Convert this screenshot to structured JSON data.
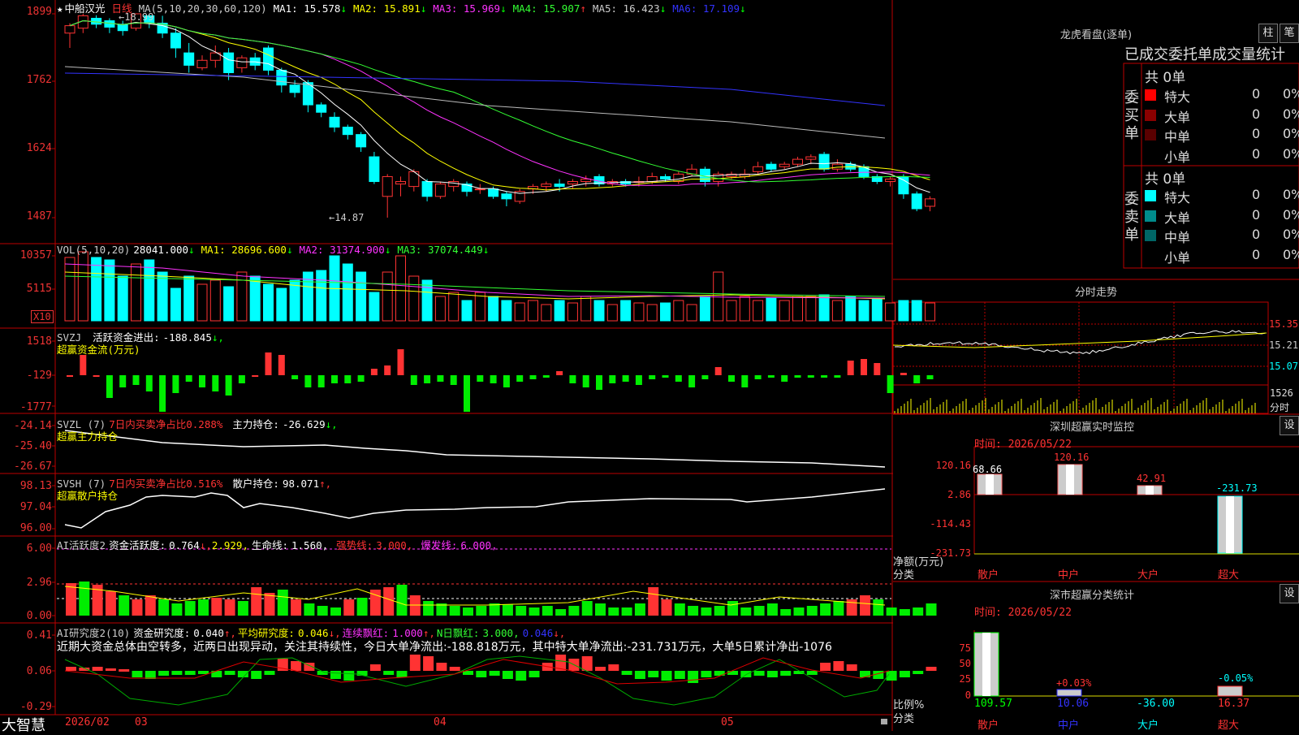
{
  "stock": {
    "star": "★",
    "name": "中船汉光",
    "period": "日线"
  },
  "price_panel": {
    "ma_label": "MA(5,10,20,30,60,120)",
    "ma": [
      {
        "label": "MA1:",
        "value": "15.578",
        "arrow": "↓",
        "color": "#ffffff"
      },
      {
        "label": "MA2:",
        "value": "15.891",
        "arrow": "↓",
        "color": "#ffff00"
      },
      {
        "label": "MA3:",
        "value": "15.969",
        "arrow": "↓",
        "color": "#ff33ff"
      },
      {
        "label": "MA4:",
        "value": "15.907",
        "arrow": "↑",
        "color": "#33ff33"
      },
      {
        "label": "MA5:",
        "value": "16.423",
        "arrow": "↓",
        "color": "#cccccc"
      },
      {
        "label": "MA6:",
        "value": "17.109",
        "arrow": "↓",
        "color": "#3333ff"
      }
    ],
    "y_labels": [
      "1899",
      "1762",
      "1624",
      "1487"
    ],
    "high_note": "←18.99",
    "low_note": "←14.87"
  },
  "vol_panel": {
    "title": "VOL(5,10,20)",
    "value": "28041.000",
    "arrow": "↓",
    "ma": [
      {
        "label": "MA1:",
        "value": "28696.600",
        "arrow": "↓",
        "color": "#ffff00"
      },
      {
        "label": "MA2:",
        "value": "31374.900",
        "arrow": "↓",
        "color": "#ff33ff"
      },
      {
        "label": "MA3:",
        "value": "37074.449",
        "arrow": "↓",
        "color": "#33ff33"
      }
    ],
    "y_labels": [
      "10357",
      "5115"
    ],
    "unit": "X10"
  },
  "svzj_panel": {
    "title": "SVZJ",
    "item": "活跃资金进出:",
    "value": "-188.845",
    "arrow": "↓,",
    "subtitle": "超赢资金流(万元)",
    "y_labels": [
      "1518",
      "-129",
      "-1777"
    ]
  },
  "svzl_panel": {
    "title": "SVZL (7)",
    "item1": "7日内买卖净占比",
    "item1_val": "0.288%",
    "item2": "主力持仓:",
    "item2_val": "-26.629",
    "arrow": "↓,",
    "subtitle": "超赢主力持仓",
    "y_labels": [
      "-24.14",
      "-25.40",
      "-26.67"
    ]
  },
  "svsh_panel": {
    "title": "SVSH (7)",
    "item1": "7日内买卖净占比",
    "item1_val": "0.516%",
    "item2": "散户持仓:",
    "item2_val": "98.071",
    "arrow": "↑,",
    "subtitle": "超赢散户持仓",
    "y_labels": [
      "98.13",
      "97.04",
      "96.00"
    ]
  },
  "ai_active_panel": {
    "title": "AI活跃度2",
    "item1": "资金活跃度:",
    "v1": "0.764",
    "v2": "2.929,",
    "item2": "生命线:",
    "v3": "1.560,",
    "item3": "强势线:",
    "v4": "3.000,",
    "item4": "爆发线:",
    "v5": "6.000,",
    "y_labels": [
      "6.00",
      "2.96",
      "0.00"
    ]
  },
  "ai_research_panel": {
    "title": "AI研究度2(10)",
    "item1": "资金研究度:",
    "v1": "0.040",
    "item2": "平均研究度:",
    "v2": "0.046",
    "item3": "连续飘红:",
    "v3": "1.000",
    "item4": "N日飘红:",
    "v4": "3.000,",
    "v5": "0.046",
    "comment": "近期大资金总体由空转多，近两日出现异动，关注其持续性，今日大单净流出:-188.818万元，其中特大单净流出:-231.731万元，大单5日累计净出-1076",
    "y_labels": [
      "0.41",
      "0.06",
      "-0.29"
    ]
  },
  "time_axis": {
    "labels": [
      "2026/02",
      "03",
      "04",
      "05"
    ]
  },
  "brand": "大智慧",
  "right_panel": {
    "dragon_title": "龙虎看盘(逐单)",
    "btn_bar": "柱",
    "btn_pen": "笔",
    "stats_title": "已成交委托单成交量统计",
    "buy_label": "委买单",
    "sell_label": "委卖单",
    "buy_total": "共 0单",
    "sell_total": "共 0单",
    "buy_rows": [
      {
        "name": "特大",
        "v1": "0",
        "v2": "0%",
        "color": "#ff0000"
      },
      {
        "name": "大单",
        "v1": "0",
        "v2": "0%",
        "color": "#8b0000"
      },
      {
        "name": "中单",
        "v1": "0",
        "v2": "0%",
        "color": "#5a0000"
      },
      {
        "name": "小单",
        "v1": "0",
        "v2": "0%",
        "color": "#000000"
      }
    ],
    "sell_rows": [
      {
        "name": "特大",
        "v1": "0",
        "v2": "0%",
        "color": "#00ffff"
      },
      {
        "name": "大单",
        "v1": "0",
        "v2": "0%",
        "color": "#008b8b"
      },
      {
        "name": "中单",
        "v1": "0",
        "v2": "0%",
        "color": "#006666"
      },
      {
        "name": "小单",
        "v1": "0",
        "v2": "0%",
        "color": "#000000"
      }
    ],
    "intraday_title": "分时走势",
    "intraday_y": [
      "15.35",
      "15.21",
      "15.07"
    ],
    "intraday_vol": "1526",
    "intraday_vol_unit": "分时",
    "monitor_title": "深圳超赢实时监控",
    "monitor_btn": "设",
    "monitor_time": "时间: 2026/05/22",
    "monitor_y": [
      "120.16",
      "2.86",
      "-114.43",
      "-231.73"
    ],
    "monitor_bar_labels": [
      "68.66",
      "120.16",
      "42.91",
      "-231.73"
    ],
    "monitor_unit": "净额(万元)",
    "monitor_class": "分类",
    "categories": [
      "散户",
      "中户",
      "大户",
      "超大"
    ],
    "class_title": "深市超赢分类统计",
    "class_btn": "设",
    "class_time": "时间: 2026/05/22",
    "class_y": [
      "75",
      "50",
      "25",
      "0"
    ],
    "class_pct": [
      "+0.03%",
      "-0.05%"
    ],
    "class_vals": [
      "109.57",
      "10.06",
      "-36.00",
      "16.37"
    ],
    "class_ratio": "比例%",
    "class_class": "分类"
  },
  "chart_data": {
    "type": "candlestick",
    "y_range": [
      14.87,
      18.99
    ],
    "candles": [
      [
        18.6,
        18.75,
        18.3,
        18.8
      ],
      [
        18.7,
        18.95,
        18.6,
        18.99
      ],
      [
        18.9,
        18.78,
        18.7,
        18.96
      ],
      [
        18.85,
        18.72,
        18.6,
        18.9
      ],
      [
        18.78,
        18.65,
        18.55,
        18.85
      ],
      [
        18.7,
        18.99,
        18.65,
        18.99
      ],
      [
        18.95,
        18.8,
        18.7,
        18.99
      ],
      [
        18.8,
        18.6,
        18.5,
        18.95
      ],
      [
        18.6,
        18.3,
        18.1,
        18.7
      ],
      [
        18.2,
        17.95,
        17.8,
        18.4
      ],
      [
        17.9,
        18.05,
        17.85,
        18.15
      ],
      [
        18.05,
        18.2,
        17.9,
        18.35
      ],
      [
        18.2,
        17.8,
        17.65,
        18.3
      ],
      [
        17.9,
        18.1,
        17.8,
        18.15
      ],
      [
        18.1,
        17.95,
        17.85,
        18.2
      ],
      [
        18.3,
        17.85,
        17.75,
        18.35
      ],
      [
        17.85,
        17.55,
        17.4,
        17.9
      ],
      [
        17.55,
        17.4,
        17.3,
        17.65
      ],
      [
        17.6,
        17.15,
        17.0,
        17.65
      ],
      [
        17.15,
        17.0,
        16.9,
        17.2
      ],
      [
        16.9,
        16.7,
        16.6,
        17.0
      ],
      [
        16.7,
        16.55,
        16.45,
        16.75
      ],
      [
        16.55,
        16.3,
        16.2,
        16.6
      ],
      [
        16.1,
        15.6,
        15.55,
        16.2
      ],
      [
        15.3,
        15.7,
        14.87,
        15.75
      ],
      [
        15.55,
        15.6,
        15.3,
        15.7
      ],
      [
        15.5,
        15.8,
        15.4,
        15.85
      ],
      [
        15.6,
        15.3,
        15.2,
        15.65
      ],
      [
        15.3,
        15.55,
        15.25,
        15.6
      ],
      [
        15.5,
        15.6,
        15.4,
        15.65
      ],
      [
        15.55,
        15.4,
        15.3,
        15.6
      ],
      [
        15.45,
        15.45,
        15.35,
        15.55
      ],
      [
        15.45,
        15.3,
        15.25,
        15.5
      ],
      [
        15.35,
        15.25,
        15.1,
        15.4
      ],
      [
        15.2,
        15.4,
        15.15,
        15.45
      ],
      [
        15.45,
        15.5,
        15.35,
        15.55
      ],
      [
        15.5,
        15.55,
        15.4,
        15.6
      ],
      [
        15.55,
        15.5,
        15.4,
        15.65
      ],
      [
        15.55,
        15.6,
        15.45,
        15.65
      ],
      [
        15.6,
        15.65,
        15.5,
        15.72
      ],
      [
        15.7,
        15.55,
        15.5,
        15.75
      ],
      [
        15.55,
        15.6,
        15.5,
        15.65
      ],
      [
        15.6,
        15.55,
        15.5,
        15.65
      ],
      [
        15.6,
        15.6,
        15.5,
        15.7
      ],
      [
        15.6,
        15.7,
        15.55,
        15.78
      ],
      [
        15.7,
        15.65,
        15.6,
        15.75
      ],
      [
        15.6,
        15.75,
        15.55,
        15.8
      ],
      [
        15.75,
        15.85,
        15.7,
        15.95
      ],
      [
        15.85,
        15.6,
        15.5,
        15.9
      ],
      [
        15.6,
        15.75,
        15.5,
        15.8
      ],
      [
        15.7,
        15.75,
        15.65,
        15.8
      ],
      [
        15.7,
        15.75,
        15.65,
        15.85
      ],
      [
        15.8,
        15.9,
        15.75,
        16.0
      ],
      [
        15.95,
        15.85,
        15.8,
        16.0
      ],
      [
        15.9,
        15.95,
        15.85,
        16.0
      ],
      [
        15.95,
        16.05,
        15.9,
        16.1
      ],
      [
        16.05,
        16.1,
        15.95,
        16.15
      ],
      [
        16.15,
        15.85,
        15.8,
        16.2
      ],
      [
        15.85,
        15.95,
        15.8,
        16.05
      ],
      [
        15.95,
        15.85,
        15.8,
        16.0
      ],
      [
        15.9,
        15.7,
        15.65,
        15.95
      ],
      [
        15.7,
        15.6,
        15.55,
        15.75
      ],
      [
        15.6,
        15.65,
        15.5,
        15.7
      ],
      [
        15.7,
        15.35,
        15.25,
        15.75
      ],
      [
        15.35,
        15.05,
        15.0,
        15.4
      ],
      [
        15.1,
        15.25,
        15.0,
        15.3
      ]
    ]
  }
}
